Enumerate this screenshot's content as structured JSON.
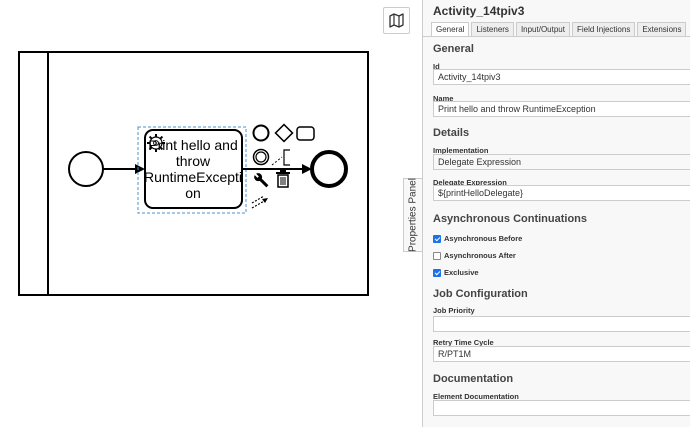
{
  "panel": {
    "title": "Activity_14tpiv3",
    "tabs": [
      "General",
      "Listeners",
      "Input/Output",
      "Field Injections",
      "Extensions"
    ],
    "toggle_label": "Properties Panel",
    "groups": {
      "general": "General",
      "details": "Details",
      "async": "Asynchronous Continuations",
      "job": "Job Configuration",
      "documentation": "Documentation"
    },
    "fields": {
      "id_label": "Id",
      "id_value": "Activity_14tpiv3",
      "name_label": "Name",
      "name_value": "Print hello and throw RuntimeException",
      "implementation_label": "Implementation",
      "implementation_value": "Delegate Expression",
      "delegate_label": "Delegate Expression",
      "delegate_value": "${printHelloDelegate}",
      "async_before_label": "Asynchronous Before",
      "async_before": true,
      "async_after_label": "Asynchronous After",
      "async_after": false,
      "exclusive_label": "Exclusive",
      "exclusive": true,
      "job_priority_label": "Job Priority",
      "job_priority_value": "",
      "retry_label": "Retry Time Cycle",
      "retry_value": "R/PT1M",
      "element_doc_label": "Element Documentation",
      "element_doc_value": ""
    }
  },
  "diagram": {
    "task_label_lines": [
      "Print hello and",
      "throw",
      "RuntimeExcepti",
      "on"
    ]
  },
  "colors": {
    "selection": "#4a90d9",
    "checkbox_on": "#1a73e8"
  }
}
